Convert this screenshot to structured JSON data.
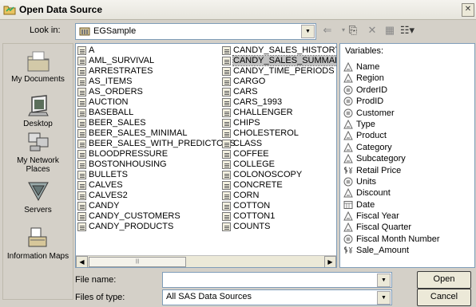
{
  "dialog": {
    "title": "Open Data Source"
  },
  "look_in": {
    "label": "Look in:",
    "value": "EGSample"
  },
  "places": [
    "My Documents",
    "Desktop",
    "My Network Places",
    "Servers",
    "Information Maps"
  ],
  "files_col1": [
    "A",
    "AML_SURVIVAL",
    "ARRESTRATES",
    "AS_ITEMS",
    "AS_ORDERS",
    "AUCTION",
    "BASEBALL",
    "BEER_SALES",
    "BEER_SALES_MINIMAL",
    "BEER_SALES_WITH_PREDICTORS",
    "BLOODPRESSURE",
    "BOSTONHOUSING",
    "BULLETS",
    "CALVES",
    "CALVES2",
    "CANDY",
    "CANDY_CUSTOMERS",
    "CANDY_PRODUCTS"
  ],
  "files_col2": [
    "CANDY_SALES_HISTORY",
    "CANDY_SALES_SUMMARY",
    "CANDY_TIME_PERIODS",
    "CARGO",
    "CARS",
    "CARS_1993",
    "CHALLENGER",
    "CHIPS",
    "CHOLESTEROL",
    "CLASS",
    "COFFEE",
    "COLLEGE",
    "COLONOSCOPY",
    "CONCRETE",
    "CORN",
    "COTTON",
    "COTTON1",
    "COUNTS"
  ],
  "selected_file": "CANDY_SALES_SUMMARY",
  "variables": {
    "header": "Variables:",
    "items": [
      {
        "name": "Name",
        "type": "char-icon"
      },
      {
        "name": "Region",
        "type": "char-icon"
      },
      {
        "name": "OrderID",
        "type": "numeric-icon"
      },
      {
        "name": "ProdID",
        "type": "numeric-icon"
      },
      {
        "name": "Customer",
        "type": "numeric-icon"
      },
      {
        "name": "Type",
        "type": "char-icon"
      },
      {
        "name": "Product",
        "type": "char-icon"
      },
      {
        "name": "Category",
        "type": "char-icon"
      },
      {
        "name": "Subcategory",
        "type": "char-icon"
      },
      {
        "name": "Retail Price",
        "type": "currency-icon"
      },
      {
        "name": "Units",
        "type": "numeric-icon"
      },
      {
        "name": "Discount",
        "type": "char-icon"
      },
      {
        "name": "Date",
        "type": "date-icon"
      },
      {
        "name": "Fiscal Year",
        "type": "char-icon"
      },
      {
        "name": "Fiscal Quarter",
        "type": "char-icon"
      },
      {
        "name": "Fiscal Month Number",
        "type": "numeric-icon"
      },
      {
        "name": "Sale_Amount",
        "type": "currency-icon"
      }
    ]
  },
  "file_name": {
    "label": "File name:",
    "value": ""
  },
  "file_type": {
    "label": "Files of type:",
    "value": "All SAS Data Sources"
  },
  "buttons": {
    "open": "Open",
    "cancel": "Cancel"
  },
  "colors": {
    "selection": "#c0c0c0",
    "border": "#7f9db9",
    "dialog_bg": "#d4d0c8"
  }
}
